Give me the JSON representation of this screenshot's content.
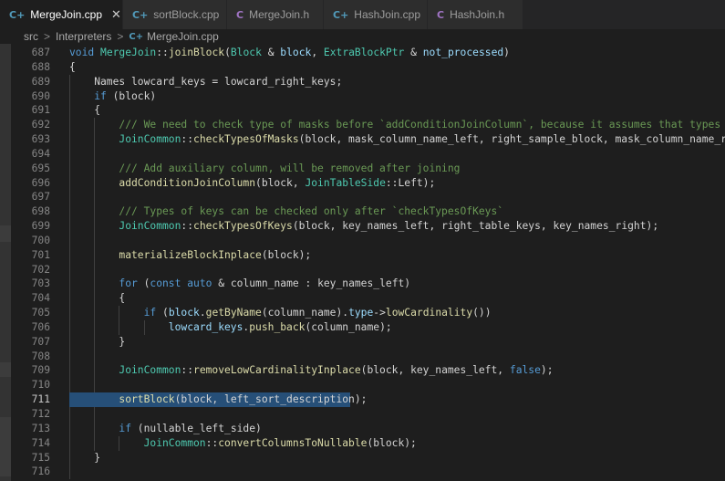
{
  "tabs": [
    {
      "label": "MergeJoin.cpp",
      "icon": "C+",
      "kind": "cpp",
      "active": true,
      "close": "✕"
    },
    {
      "label": "sortBlock.cpp",
      "icon": "C+",
      "kind": "cpp",
      "active": false
    },
    {
      "label": "MergeJoin.h",
      "icon": "C",
      "kind": "h",
      "active": false
    },
    {
      "label": "HashJoin.cpp",
      "icon": "C+",
      "kind": "cpp",
      "active": false
    },
    {
      "label": "HashJoin.h",
      "icon": "C",
      "kind": "h",
      "active": false
    }
  ],
  "breadcrumb": {
    "parts": [
      "src",
      "Interpreters"
    ],
    "file": "MergeJoin.cpp",
    "file_icon": "C+",
    "separator": ">"
  },
  "editor": {
    "current_line": "711",
    "selected_line": "711",
    "lines": [
      {
        "n": "687",
        "indent": 0,
        "tokens": [
          {
            "t": "void ",
            "c": "kw"
          },
          {
            "t": "MergeJoin",
            "c": "ty"
          },
          {
            "t": "::",
            "c": "pl"
          },
          {
            "t": "joinBlock",
            "c": "fn"
          },
          {
            "t": "(",
            "c": "pl"
          },
          {
            "t": "Block",
            "c": "ty"
          },
          {
            "t": " & ",
            "c": "pl"
          },
          {
            "t": "block",
            "c": "var"
          },
          {
            "t": ", ",
            "c": "pl"
          },
          {
            "t": "ExtraBlockPtr",
            "c": "ty"
          },
          {
            "t": " & ",
            "c": "pl"
          },
          {
            "t": "not_processed",
            "c": "var"
          },
          {
            "t": ")",
            "c": "pl"
          }
        ]
      },
      {
        "n": "688",
        "indent": 0,
        "tokens": [
          {
            "t": "{",
            "c": "pl"
          }
        ]
      },
      {
        "n": "689",
        "indent": 1,
        "tokens": [
          {
            "t": "Names",
            "c": "pl"
          },
          {
            "t": " lowcard_keys = lowcard_right_keys;",
            "c": "pl"
          }
        ]
      },
      {
        "n": "690",
        "indent": 1,
        "tokens": [
          {
            "t": "if",
            "c": "kw"
          },
          {
            "t": " (block)",
            "c": "pl"
          }
        ]
      },
      {
        "n": "691",
        "indent": 1,
        "tokens": [
          {
            "t": "{",
            "c": "pl"
          }
        ]
      },
      {
        "n": "692",
        "indent": 2,
        "tokens": [
          {
            "t": "/// We need to check type of masks before `addConditionJoinColumn`, because it assumes that types is correct",
            "c": "cm"
          }
        ]
      },
      {
        "n": "693",
        "indent": 2,
        "tokens": [
          {
            "t": "JoinCommon",
            "c": "ty"
          },
          {
            "t": "::",
            "c": "pl"
          },
          {
            "t": "checkTypesOfMasks",
            "c": "fn"
          },
          {
            "t": "(block, mask_column_name_left, right_sample_block, mask_column_name_right);",
            "c": "pl"
          }
        ]
      },
      {
        "n": "694",
        "indent": 2,
        "tokens": []
      },
      {
        "n": "695",
        "indent": 2,
        "tokens": [
          {
            "t": "/// Add auxiliary column, will be removed after joining",
            "c": "cm"
          }
        ]
      },
      {
        "n": "696",
        "indent": 2,
        "tokens": [
          {
            "t": "addConditionJoinColumn",
            "c": "fn"
          },
          {
            "t": "(block, ",
            "c": "pl"
          },
          {
            "t": "JoinTableSide",
            "c": "ty"
          },
          {
            "t": "::Left);",
            "c": "pl"
          }
        ]
      },
      {
        "n": "697",
        "indent": 2,
        "tokens": []
      },
      {
        "n": "698",
        "indent": 2,
        "tokens": [
          {
            "t": "/// Types of keys can be checked only after `checkTypesOfKeys`",
            "c": "cm"
          }
        ]
      },
      {
        "n": "699",
        "indent": 2,
        "tokens": [
          {
            "t": "JoinCommon",
            "c": "ty"
          },
          {
            "t": "::",
            "c": "pl"
          },
          {
            "t": "checkTypesOfKeys",
            "c": "fn"
          },
          {
            "t": "(block, key_names_left, right_table_keys, key_names_right);",
            "c": "pl"
          }
        ]
      },
      {
        "n": "700",
        "indent": 2,
        "tokens": []
      },
      {
        "n": "701",
        "indent": 2,
        "tokens": [
          {
            "t": "materializeBlockInplace",
            "c": "fn"
          },
          {
            "t": "(block);",
            "c": "pl"
          }
        ]
      },
      {
        "n": "702",
        "indent": 2,
        "tokens": []
      },
      {
        "n": "703",
        "indent": 2,
        "tokens": [
          {
            "t": "for",
            "c": "kw"
          },
          {
            "t": " (",
            "c": "pl"
          },
          {
            "t": "const",
            "c": "kw"
          },
          {
            "t": " ",
            "c": "pl"
          },
          {
            "t": "auto",
            "c": "kw"
          },
          {
            "t": " & column_name : key_names_left)",
            "c": "pl"
          }
        ]
      },
      {
        "n": "704",
        "indent": 2,
        "tokens": [
          {
            "t": "{",
            "c": "pl"
          }
        ]
      },
      {
        "n": "705",
        "indent": 3,
        "tokens": [
          {
            "t": "if",
            "c": "kw"
          },
          {
            "t": " (",
            "c": "pl"
          },
          {
            "t": "block",
            "c": "var"
          },
          {
            "t": ".",
            "c": "pl"
          },
          {
            "t": "getByName",
            "c": "fn"
          },
          {
            "t": "(column_name).",
            "c": "pl"
          },
          {
            "t": "type",
            "c": "var"
          },
          {
            "t": "->",
            "c": "pl"
          },
          {
            "t": "lowCardinality",
            "c": "fn"
          },
          {
            "t": "())",
            "c": "pl"
          }
        ]
      },
      {
        "n": "706",
        "indent": 4,
        "tokens": [
          {
            "t": "lowcard_keys",
            "c": "var"
          },
          {
            "t": ".",
            "c": "pl"
          },
          {
            "t": "push_back",
            "c": "fn"
          },
          {
            "t": "(column_name);",
            "c": "pl"
          }
        ]
      },
      {
        "n": "707",
        "indent": 2,
        "tokens": [
          {
            "t": "}",
            "c": "pl"
          }
        ]
      },
      {
        "n": "708",
        "indent": 2,
        "tokens": []
      },
      {
        "n": "709",
        "indent": 2,
        "tokens": [
          {
            "t": "JoinCommon",
            "c": "ty"
          },
          {
            "t": "::",
            "c": "pl"
          },
          {
            "t": "removeLowCardinalityInplace",
            "c": "fn"
          },
          {
            "t": "(block, key_names_left, ",
            "c": "pl"
          },
          {
            "t": "false",
            "c": "kw"
          },
          {
            "t": ");",
            "c": "pl"
          }
        ]
      },
      {
        "n": "710",
        "indent": 2,
        "tokens": []
      },
      {
        "n": "711",
        "indent": 2,
        "tokens": [
          {
            "t": "sortBlock",
            "c": "fn"
          },
          {
            "t": "(block, left_sort_description);",
            "c": "pl"
          }
        ]
      },
      {
        "n": "712",
        "indent": 2,
        "tokens": []
      },
      {
        "n": "713",
        "indent": 2,
        "tokens": [
          {
            "t": "if",
            "c": "kw"
          },
          {
            "t": " (nullable_left_side)",
            "c": "pl"
          }
        ]
      },
      {
        "n": "714",
        "indent": 3,
        "tokens": [
          {
            "t": "JoinCommon",
            "c": "ty"
          },
          {
            "t": "::",
            "c": "pl"
          },
          {
            "t": "convertColumnsToNullable",
            "c": "fn"
          },
          {
            "t": "(block);",
            "c": "pl"
          }
        ]
      },
      {
        "n": "715",
        "indent": 1,
        "tokens": [
          {
            "t": "}",
            "c": "pl"
          }
        ]
      },
      {
        "n": "716",
        "indent": 1,
        "tokens": []
      }
    ]
  }
}
